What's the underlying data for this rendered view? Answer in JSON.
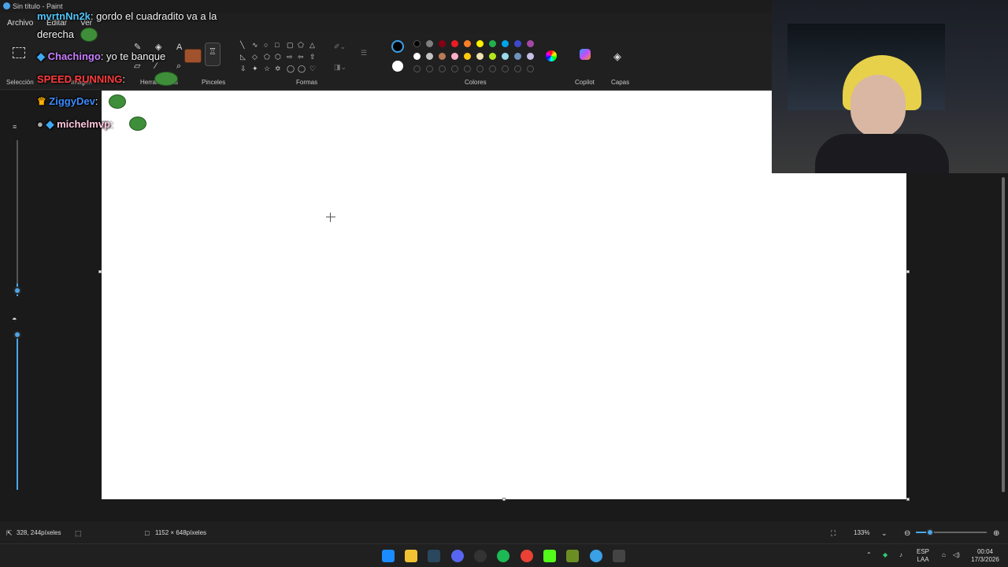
{
  "window": {
    "title": "Sin título - Paint"
  },
  "menu": {
    "file": "Archivo",
    "edit": "Editar",
    "view": "Ver"
  },
  "ribbon": {
    "selection": "Selección",
    "image": "Imagen",
    "tools": "Herramientas",
    "brushes": "Pinceles",
    "shapes": "Formas",
    "colors": "Colores",
    "copilot": "Copilot",
    "layers": "Capas"
  },
  "palette": {
    "row1": [
      "#000000",
      "#7f7f7f",
      "#880015",
      "#ed1c24",
      "#ff7f27",
      "#fff200",
      "#22b14c",
      "#00a2e8",
      "#3f48cc",
      "#a349a4"
    ],
    "row2": [
      "#ffffff",
      "#c3c3c3",
      "#b97a57",
      "#ffaec9",
      "#ffc90e",
      "#efe4b0",
      "#b5e61d",
      "#99d9ea",
      "#7092be",
      "#c8bfe7"
    ]
  },
  "status": {
    "cursor_position": "328, 244píxeles",
    "canvas_size": "1152 × 648píxeles",
    "zoom": "133%",
    "zoom_fraction": 0.2
  },
  "taskbar": {
    "language_top": "ESP",
    "language_bottom": "LAA",
    "time": "00:04",
    "date": "17/3/2026"
  },
  "chat": {
    "line1_user": "mvrtnNn2k",
    "line1_msg": ": gordo el cuadradito va a la",
    "line1_cont": "derecha",
    "line2_user": "Chachingo",
    "line2_msg": ": yo te banque",
    "line3_user": "SPEED RUNNING",
    "line3_msg": ":",
    "line4_user": "ZiggyDev",
    "line4_msg": ":",
    "line5_user": "michelmvp",
    "line5_msg": ":"
  }
}
